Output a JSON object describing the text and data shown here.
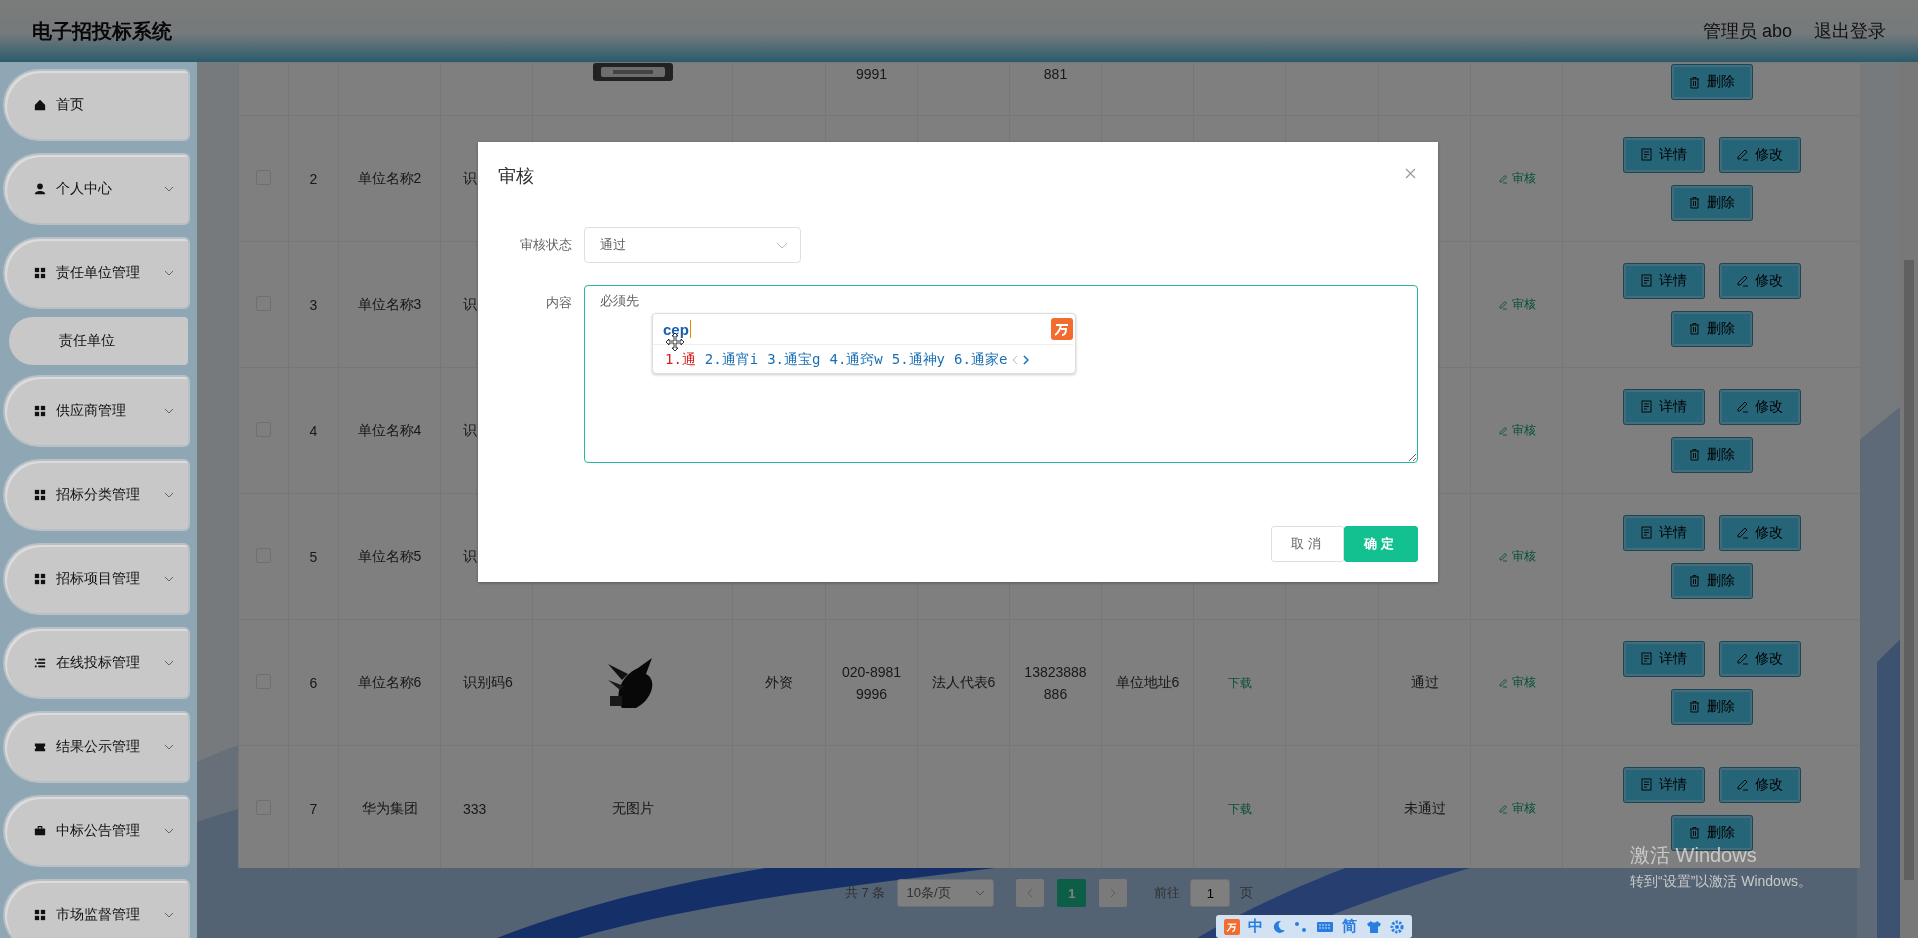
{
  "header": {
    "title": "电子招投标系统",
    "user": "管理员 abo",
    "logout": "退出登录"
  },
  "sidebar": {
    "items": [
      {
        "label": "首页",
        "kind": "home",
        "expandable": false
      },
      {
        "label": "个人中心",
        "kind": "user",
        "expandable": true
      },
      {
        "label": "责任单位管理",
        "kind": "grid",
        "expandable": true,
        "children": [
          {
            "label": "责任单位"
          }
        ]
      },
      {
        "label": "供应商管理",
        "kind": "grid",
        "expandable": true
      },
      {
        "label": "招标分类管理",
        "kind": "grid",
        "expandable": true
      },
      {
        "label": "招标项目管理",
        "kind": "grid",
        "expandable": true
      },
      {
        "label": "在线投标管理",
        "kind": "list",
        "expandable": true
      },
      {
        "label": "结果公示管理",
        "kind": "ticket",
        "expandable": true
      },
      {
        "label": "中标公告管理",
        "kind": "briefcase",
        "expandable": true
      },
      {
        "label": "市场监督管理",
        "kind": "grid",
        "expandable": true
      }
    ]
  },
  "table": {
    "rows": [
      {
        "image": {
          "kind": "picture"
        },
        "phone": "9991",
        "mobile": "881",
        "actions": [
          {
            "kind": "delete",
            "label": "删除"
          }
        ]
      },
      {
        "checked": false,
        "index": "2",
        "name": "单位名称2",
        "code": "识",
        "audit": "审核",
        "actions": [
          {
            "kind": "detail",
            "label": "详情"
          },
          {
            "kind": "edit",
            "label": "修改"
          },
          {
            "kind": "delete",
            "label": "删除"
          }
        ]
      },
      {
        "checked": false,
        "index": "3",
        "name": "单位名称3",
        "code": "识",
        "audit": "审核",
        "actions": [
          {
            "kind": "detail",
            "label": "详情"
          },
          {
            "kind": "edit",
            "label": "修改"
          },
          {
            "kind": "delete",
            "label": "删除"
          }
        ]
      },
      {
        "checked": false,
        "index": "4",
        "name": "单位名称4",
        "code": "识",
        "audit": "审核",
        "actions": [
          {
            "kind": "detail",
            "label": "详情"
          },
          {
            "kind": "edit",
            "label": "修改"
          },
          {
            "kind": "delete",
            "label": "删除"
          }
        ]
      },
      {
        "checked": false,
        "index": "5",
        "name": "单位名称5",
        "code": "识",
        "audit": "审核",
        "actions": [
          {
            "kind": "detail",
            "label": "详情"
          },
          {
            "kind": "edit",
            "label": "修改"
          },
          {
            "kind": "delete",
            "label": "删除"
          }
        ]
      },
      {
        "checked": false,
        "index": "6",
        "name": "单位名称6",
        "code": "识别码6",
        "image": {
          "kind": "picture"
        },
        "type": "外资",
        "phone": "020-89819996",
        "legal": "法人代表6",
        "mobile": "13823888886",
        "address": "单位地址6",
        "file": "下载",
        "status": "通过",
        "audit": "审核",
        "actions": [
          {
            "kind": "detail",
            "label": "详情"
          },
          {
            "kind": "edit",
            "label": "修改"
          },
          {
            "kind": "delete",
            "label": "删除"
          }
        ]
      },
      {
        "checked": false,
        "index": "7",
        "name": "华为集团",
        "code": "333",
        "image": {
          "kind": "text",
          "text": "无图片"
        },
        "file": "下载",
        "status": "未通过",
        "audit": "审核",
        "actions": [
          {
            "kind": "detail",
            "label": "详情"
          },
          {
            "kind": "edit",
            "label": "修改"
          },
          {
            "kind": "delete",
            "label": "删除"
          }
        ]
      }
    ]
  },
  "pagination": {
    "total": "共 7 条",
    "page_size": "10条/页",
    "pages": [
      {
        "label": "1",
        "selected": true
      }
    ],
    "goto_label": "前往",
    "goto_value": "1",
    "goto_suffix": "页"
  },
  "dialog": {
    "title": "审核",
    "fields": [
      {
        "kind": "select",
        "label": "审核状态",
        "value": "通过"
      },
      {
        "kind": "textarea",
        "label": "内容",
        "value": "必须先"
      }
    ],
    "buttons": [
      {
        "kind": "default",
        "label": "取消"
      },
      {
        "kind": "primary",
        "label": "确定"
      }
    ]
  },
  "ime_popup": {
    "composition": "cep",
    "candidates": [
      {
        "label": "1.通",
        "selected": true
      },
      {
        "label": "2.通宵i",
        "selected": false
      },
      {
        "label": "3.通宝g",
        "selected": false
      },
      {
        "label": "4.通窍w",
        "selected": false
      },
      {
        "label": "5.通神y",
        "selected": false
      },
      {
        "label": "6.通家e",
        "selected": false
      }
    ]
  },
  "ime_toolbar": {
    "mode": "中",
    "charset": "简"
  },
  "os_notice": {
    "title": "激活 Windows",
    "hint": "转到“设置”以激活 Windows。"
  }
}
